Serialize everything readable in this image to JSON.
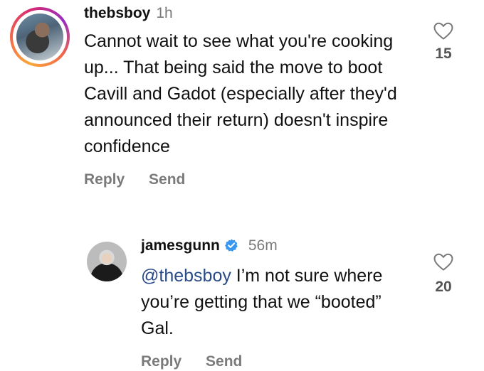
{
  "comments": [
    {
      "username": "thebsboy",
      "time": "1h",
      "text": "Cannot wait to see what you're cooking up... That being said the move to boot Cavill and Gadot (especially after they'd announced their return) doesn't inspire confidence",
      "likes": "15",
      "reply_label": "Reply",
      "send_label": "Send"
    },
    {
      "username": "jamesgunn",
      "verified": true,
      "time": "56m",
      "mention": "@thebsboy",
      "text": " I’m not sure where you’re getting that we “booted” Gal.",
      "likes": "20",
      "reply_label": "Reply",
      "send_label": "Send"
    }
  ],
  "colors": {
    "verified_badge": "#3897f0",
    "mention": "#2a4a8a",
    "muted": "#7a7a7a"
  },
  "icons": [
    "heart-outline-icon",
    "verified-badge-icon"
  ]
}
